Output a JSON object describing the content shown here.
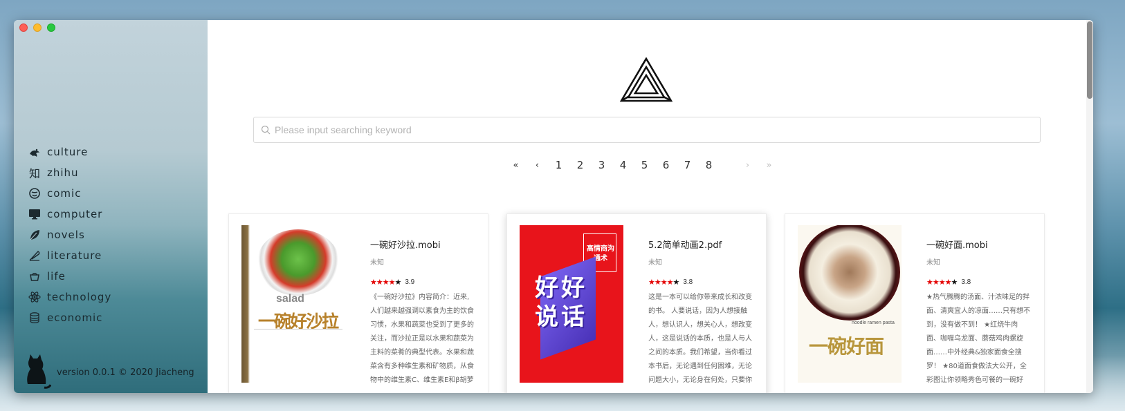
{
  "window": {
    "title": ""
  },
  "sidebar": {
    "items": [
      {
        "label": "culture",
        "icon": "dragon-icon"
      },
      {
        "label": "zhihu",
        "icon": "zhihu-icon",
        "glyph": "知"
      },
      {
        "label": "comic",
        "icon": "comic-icon"
      },
      {
        "label": "computer",
        "icon": "monitor-icon"
      },
      {
        "label": "novels",
        "icon": "leaf-icon"
      },
      {
        "label": "literature",
        "icon": "quill-icon"
      },
      {
        "label": "life",
        "icon": "basket-icon"
      },
      {
        "label": "technology",
        "icon": "atom-icon"
      },
      {
        "label": "economic",
        "icon": "coins-icon"
      }
    ],
    "footer": {
      "version": "version 0.0.1 © 2020 Jiacheng"
    }
  },
  "search": {
    "placeholder": "Please input searching keyword",
    "value": ""
  },
  "pagination": {
    "first": "«",
    "prev": "‹",
    "pages": [
      "1",
      "2",
      "3",
      "4",
      "5",
      "6",
      "7",
      "8"
    ],
    "next": "›",
    "last": "»"
  },
  "books": [
    {
      "title": "一碗好沙拉.mobi",
      "author": "未知",
      "rating": "3.9",
      "stars": 4,
      "description": "《一碗好沙拉》内容简介：近来,人们越来越强调以素食为主的饮食习惯，水果和蔬菜也受到了更多的关注，而沙拉正是以水果和蔬菜为主料的菜肴的典型代表。水果和蔬菜含有多种维生素和矿物质，从食物中的维生素C、维生素E和β胡萝",
      "cover_title": "一碗好沙拉",
      "cover_subtitle": "salad"
    },
    {
      "title": "5.2简单动画2.pdf",
      "author": "未知",
      "rating": "3.8",
      "stars": 4,
      "description": "这是一本可以给你带来成长和改变的书。 人要说话，因为人想接触人，想认识人，想关心人，想改变人，这是说话的本质，也是人与人之间的本质。我们希望，当你看过本书后，无论遇到任何困难，无论问题大小，无论身在何处，只要你",
      "cover_title": "好好说话",
      "cover_subtitle": "高情商沟通术"
    },
    {
      "title": "一碗好面.mobi",
      "author": "未知",
      "rating": "3.8",
      "stars": 4,
      "description": "★热气腾腾的汤面、汁浓味足的拌面、清爽宜人的凉面……只有想不到，没有做不到！ ★红烧牛肉面、咖喱乌龙面、蘑菇鸡肉螺旋面……中外经典&独家面食全搜罗！ ★80道面食做法大公开，全彩图让你领略秀色可餐的一碗好",
      "cover_title": "一碗好面",
      "cover_subtitle": "noodle ramen pasta"
    }
  ],
  "colors": {
    "star": "#e40000",
    "cover_red": "#e8141b",
    "cover_purple": "#5b3fd6",
    "cover_gold": "#b8963c"
  }
}
